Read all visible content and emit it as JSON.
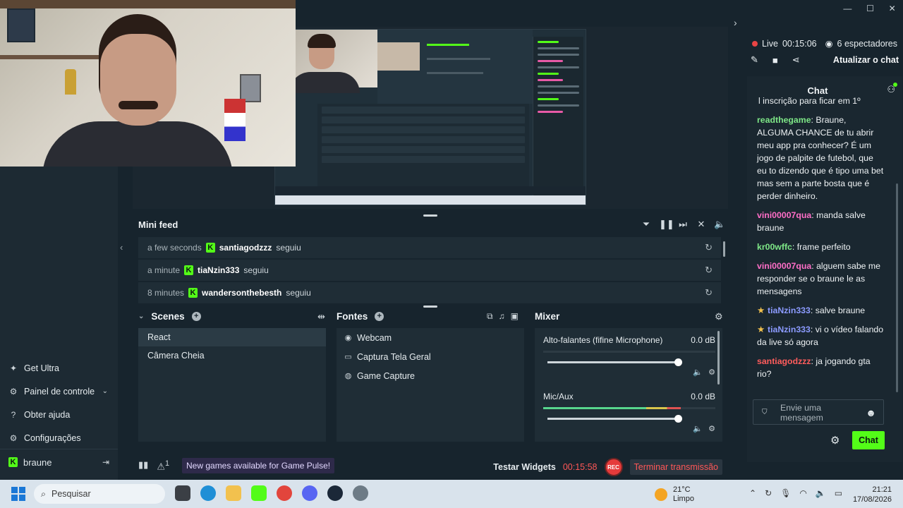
{
  "sidebar": {
    "items": [
      {
        "icon": "ultra-icon",
        "label": "Get Ultra"
      },
      {
        "icon": "dashboard-icon",
        "label": "Painel de controle"
      },
      {
        "icon": "help-icon",
        "label": "Obter ajuda"
      },
      {
        "icon": "settings-icon",
        "label": "Configurações"
      }
    ],
    "user": "braune"
  },
  "mini_feed": {
    "title": "Mini feed",
    "events": [
      {
        "time": "a few seconds",
        "user": "santiagodzzz",
        "action": "seguiu"
      },
      {
        "time": "a minute",
        "user": "tiaNzin333",
        "action": "seguiu"
      },
      {
        "time": "8 minutes",
        "user": "wandersonthebesth",
        "action": "seguiu"
      }
    ]
  },
  "scenes": {
    "title": "Scenes",
    "items": [
      "React",
      "Câmera Cheia"
    ]
  },
  "sources": {
    "title": "Fontes",
    "items": [
      {
        "icon": "webcam-icon",
        "label": "Webcam"
      },
      {
        "icon": "monitor-icon",
        "label": "Captura Tela Geral"
      },
      {
        "icon": "gamepad-icon",
        "label": "Game Capture"
      }
    ]
  },
  "mixer": {
    "title": "Mixer",
    "channels": [
      {
        "name": "Alto-falantes (fifine Microphone)",
        "db": "0.0 dB",
        "volume": 1.0
      },
      {
        "name": "Mic/Aux",
        "db": "0.0 dB",
        "volume": 1.0
      }
    ]
  },
  "status": {
    "warnings": "1",
    "notification": "New games available for Game Pulse!",
    "test_widgets": "Testar Widgets",
    "stream_time": "00:15:58",
    "rec_label": "REC",
    "end_stream": "Terminar transmissão"
  },
  "live": {
    "label": "Live",
    "time": "00:15:06",
    "viewers": "6 espectadores",
    "refresh_chat": "Atualizar o chat"
  },
  "chat": {
    "title": "Chat",
    "pinned": "l inscrição para ficar em 1º",
    "messages": [
      {
        "user": "readthegame",
        "color": "#7ee787",
        "badge": false,
        "text": "Braune, ALGUMA CHANCE de tu abrir meu app pra conhecer? É um jogo de palpite de futebol, que eu to dizendo que é tipo uma bet mas sem a parte bosta que é perder dinheiro."
      },
      {
        "user": "vini00007qua",
        "color": "#ff6ec7",
        "badge": false,
        "text": "manda salve braune"
      },
      {
        "user": "kr00wffc",
        "color": "#7ee787",
        "badge": false,
        "text": "frame perfeito"
      },
      {
        "user": "vini00007qua",
        "color": "#ff6ec7",
        "badge": false,
        "text": "alguem sabe me responder se o braune le as mensagens"
      },
      {
        "user": "tiaNzin333",
        "color": "#8c9bff",
        "badge": true,
        "text": "salve braune"
      },
      {
        "user": "tiaNzin333",
        "color": "#8c9bff",
        "badge": true,
        "text": "vi o vídeo falando da live só agora"
      },
      {
        "user": "santiagodzzz",
        "color": "#ff5c5c",
        "badge": false,
        "text": "ja jogando gta rio?"
      }
    ],
    "input_placeholder": "Envie uma mensagem",
    "send_label": "Chat"
  },
  "taskbar": {
    "search": "Pesquisar",
    "temperature": "21°C",
    "weather": "Limpo",
    "time": "21:21",
    "date": "17/08/2026"
  }
}
